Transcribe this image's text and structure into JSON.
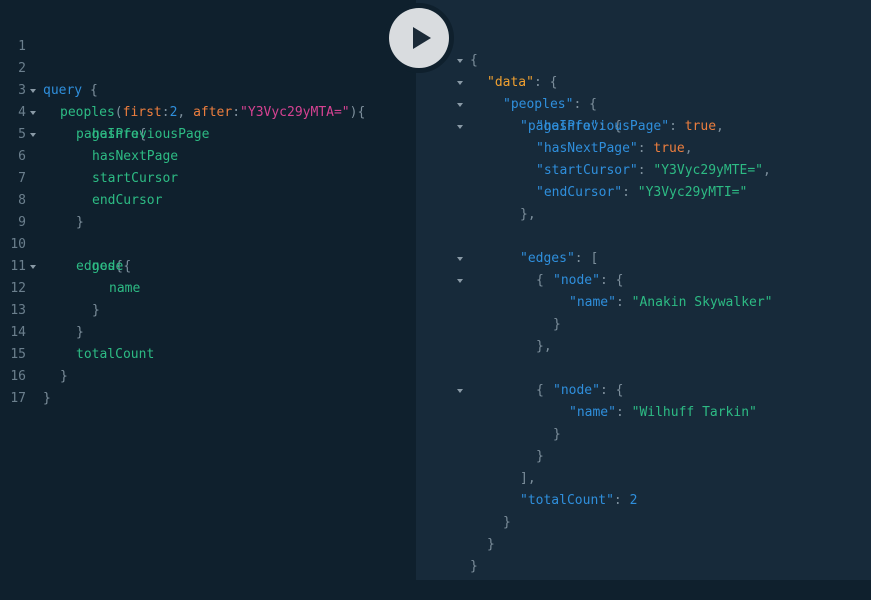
{
  "query_editor": {
    "line_numbers": [
      "1",
      "2",
      "3",
      "4",
      "5",
      "6",
      "7",
      "8",
      "9",
      "10",
      "11",
      "12",
      "13",
      "14",
      "15",
      "16",
      "17"
    ],
    "query_keyword": "query",
    "open_brace": "{",
    "root_field": "peoples",
    "paren_open": "(",
    "arg1_name": "first",
    "arg1_value": "2",
    "arg2_name": "after",
    "arg2_value": "\"Y3Vyc29yMTA=\"",
    "colon": ":",
    "comma": ",",
    "paren_close_brace": "){",
    "pageInfo": "pageInfo",
    "brace": "{",
    "hasPreviousPage": "hasPreviousPage",
    "hasNextPage": "hasNextPage",
    "startCursor": "startCursor",
    "endCursor": "endCursor",
    "close_brace": "}",
    "edges": "edges",
    "node": "node",
    "name": "name",
    "totalCount": "totalCount"
  },
  "run_button": {
    "icon": "play-icon",
    "label": "Run query"
  },
  "result_viewer": {
    "open_brace": "{",
    "close_brace": "}",
    "close_brace_comma": "},",
    "open_bracket": "[",
    "close_bracket_comma": "],",
    "colon_brace": ": {",
    "colon_bracket": ": [",
    "key_data": "\"data\"",
    "key_peoples": "\"peoples\"",
    "key_pageInfo": "\"pageInfo\"",
    "key_hasPreviousPage": "\"hasPreviousPage\"",
    "key_hasNextPage": "\"hasNextPage\"",
    "key_startCursor": "\"startCursor\"",
    "key_endCursor": "\"endCursor\"",
    "key_edges": "\"edges\"",
    "key_node": "\"node\"",
    "key_name": "\"name\"",
    "key_totalCount": "\"totalCount\"",
    "colon": ": ",
    "comma": ",",
    "val_hasPreviousPage": "true",
    "val_hasNextPage": "true",
    "val_startCursor": "\"Y3Vyc29yMTE=\"",
    "val_endCursor": "\"Y3Vyc29yMTI=\"",
    "val_name_1": "\"Anakin Skywalker\"",
    "val_name_2": "\"Wilhuff Tarkin\"",
    "val_totalCount": "2"
  },
  "colors": {
    "editor_bg": "#0f202d",
    "result_bg": "#172a3a",
    "keyword": "#2f8fdc",
    "field": "#2dbb84",
    "argument": "#ed7e3e",
    "string_arg": "#d64292",
    "data_key": "#f0a030"
  }
}
